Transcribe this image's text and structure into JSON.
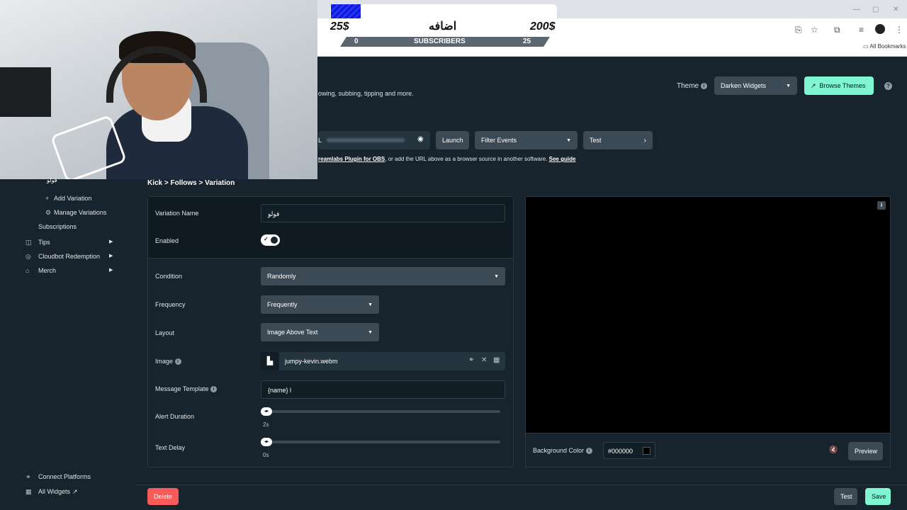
{
  "browser": {
    "all_bookmarks": "All Bookmarks"
  },
  "overlay": {
    "left_amount": "25$",
    "right_amount": "200$",
    "center_text": "اضافه",
    "bar_left": "0",
    "bar_label": "SUBSCRIBERS",
    "bar_right": "25"
  },
  "header": {
    "description": "owing, subbing, tipping and more.",
    "theme_label": "Theme",
    "theme_value": "Darken Widgets",
    "browse_themes": "Browse Themes"
  },
  "url_bar": {
    "url_label": "L",
    "launch": "Launch",
    "filter_events": "Filter Events",
    "test": "Test",
    "help_prefix": "reamlabs Plugin for OBS",
    "help_middle": ", or add the URL above as a browser source in another software. ",
    "help_link": "See guide"
  },
  "sidebar": {
    "variation_item": "فولو",
    "add_variation": "Add Variation",
    "manage_variations": "Manage Variations",
    "subscriptions": "Subscriptions",
    "tips": "Tips",
    "cloudbot": "Cloudbot Redemption",
    "merch": "Merch",
    "connect_platforms": "Connect Platforms",
    "all_widgets": "All Widgets"
  },
  "breadcrumb": "Kick > Follows > Variation",
  "form": {
    "variation_name_label": "Variation Name",
    "variation_name_value": "فولو",
    "enabled_label": "Enabled",
    "enabled": true,
    "condition_label": "Condition",
    "condition_value": "Randomly",
    "frequency_label": "Frequency",
    "frequency_value": "Frequently",
    "layout_label": "Layout",
    "layout_value": "Image Above Text",
    "image_label": "Image",
    "image_file": "jumpy-kevin.webm",
    "message_template_label": "Message Template",
    "message_template_value": "{name} l",
    "alert_duration_label": "Alert Duration",
    "alert_duration_value": "2s",
    "text_delay_label": "Text Delay",
    "text_delay_value": "0s"
  },
  "preview": {
    "background_color_label": "Background Color",
    "background_color_value": "#000000",
    "preview_button": "Preview"
  },
  "footer": {
    "delete": "Delete",
    "test": "Test",
    "save": "Save"
  },
  "colors": {
    "accent": "#80f5d2",
    "danger": "#f85a5a",
    "background": "#17242d"
  }
}
